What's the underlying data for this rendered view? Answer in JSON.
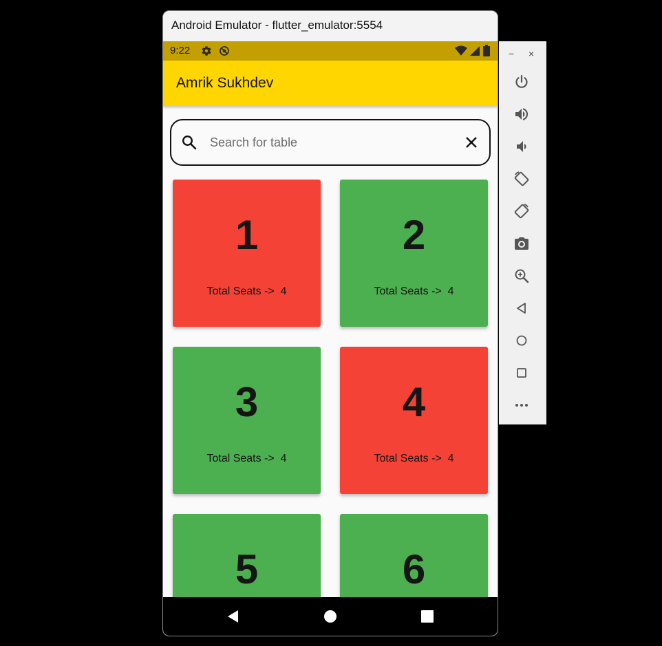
{
  "window": {
    "title": "Android Emulator - flutter_emulator:5554"
  },
  "statusbar": {
    "time": "9:22",
    "bg_color": "#c3a000"
  },
  "appbar": {
    "title": "Amrik Sukhdev",
    "bg_color": "#ffd600"
  },
  "search": {
    "placeholder": "Search for table",
    "value": ""
  },
  "colors": {
    "occupied": "#f44336",
    "available": "#4caf50"
  },
  "tables": [
    {
      "number": "1",
      "seats_label": "Total Seats ->  4",
      "status": "occupied"
    },
    {
      "number": "2",
      "seats_label": "Total Seats ->  4",
      "status": "available"
    },
    {
      "number": "3",
      "seats_label": "Total Seats ->  4",
      "status": "available"
    },
    {
      "number": "4",
      "seats_label": "Total Seats ->  4",
      "status": "occupied"
    },
    {
      "number": "5",
      "seats_label": "",
      "status": "available"
    },
    {
      "number": "6",
      "seats_label": "",
      "status": "available"
    }
  ],
  "toolbar": {
    "minimize": "−",
    "close": "×",
    "buttons": [
      "power-icon",
      "volume-up-icon",
      "volume-down-icon",
      "rotate-left-icon",
      "rotate-right-icon",
      "camera-icon",
      "zoom-icon",
      "back-icon",
      "home-icon",
      "overview-icon",
      "more-icon"
    ]
  }
}
